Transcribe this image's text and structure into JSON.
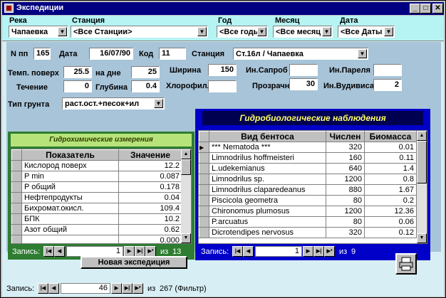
{
  "window": {
    "title": "Экспедиции"
  },
  "filters": {
    "river": {
      "label": "Река",
      "value": "Чапаевка"
    },
    "station": {
      "label": "Станция",
      "value": "<Все Станции>"
    },
    "year": {
      "label": "Год",
      "value": "<Все годы"
    },
    "month": {
      "label": "Месяц",
      "value": "<Все месяц"
    },
    "date": {
      "label": "Дата",
      "value": "<Все Даты"
    }
  },
  "record": {
    "npp_label": "N пп",
    "npp": "165",
    "date_label": "Дата",
    "date": "16/07/90",
    "code_label": "Код",
    "code": "11",
    "station_label": "Станция",
    "station": "Ст.16л / Чапаевка",
    "temp_surface_label": "Темп. поверх",
    "temp_surface": "25.5",
    "bottom_label": "на дне",
    "bottom": "25",
    "width_label": "Ширина",
    "width": "150",
    "saprob_label": "Ин.Сапроб",
    "saprob": "",
    "pareli_label": "Ин.Пареля",
    "pareli": "",
    "current_label": "Течение",
    "current": "0",
    "depth_label": "Глубина",
    "depth": "0.4",
    "chlorophyll_label": "Хлорофилл",
    "chlorophyll": "",
    "transparency_label": "Прозрачн",
    "transparency": "30",
    "woodiwiss_label": "Ин.Вудивиса",
    "woodiwiss": "2",
    "soil_label": "Тип грунта",
    "soil": "раст.ост.+песок+ил"
  },
  "hydrochem": {
    "title": "Гидрохимические измерения",
    "columns": [
      "Показатель",
      "Значение"
    ],
    "rows": [
      [
        "Кислород поверх",
        "12.2"
      ],
      [
        "P min",
        "0.087"
      ],
      [
        "P общий",
        "0.178"
      ],
      [
        "Нефтепродукты",
        "0.04"
      ],
      [
        "Бихромат.окисл.",
        "109.4"
      ],
      [
        "БПК",
        "10.2"
      ],
      [
        "Азот общий",
        "0.62"
      ],
      [
        "",
        "0.000"
      ]
    ],
    "nav": {
      "label": "Запись:",
      "current": "1",
      "of": "из",
      "total": "13"
    }
  },
  "hydrobio": {
    "title": "Гидробиологические наблюдения",
    "columns": [
      "Вид бентоса",
      "Числен",
      "Биомасса"
    ],
    "rows": [
      [
        "*** Nematoda ***",
        "320",
        "0.01"
      ],
      [
        "Limnodrilus hoffmeisteri",
        "160",
        "0.11"
      ],
      [
        "L.udekemianus",
        "640",
        "1.4"
      ],
      [
        "Limnodrilus sp.",
        "1200",
        "0.8"
      ],
      [
        "Limnodrilus claparedeanus",
        "880",
        "1.67"
      ],
      [
        "Piscicola geometra",
        "80",
        "0.2"
      ],
      [
        "Chironomus plumosus",
        "1200",
        "12.36"
      ],
      [
        "P.arcuatus",
        "80",
        "0.06"
      ],
      [
        "Dicrotendipes nervosus",
        "320",
        "0.12"
      ]
    ],
    "nav": {
      "label": "Запись:",
      "current": "1",
      "of": "из",
      "total": "9"
    }
  },
  "actions": {
    "new_expedition": "Новая экспедиция"
  },
  "main_nav": {
    "label": "Запись:",
    "current": "46",
    "of": "из",
    "total": "267 (Фильтр)"
  },
  "nav_glyphs": {
    "first": "|◀",
    "prev": "◀",
    "next": "▶",
    "last": "▶|",
    "new": "▶*"
  }
}
